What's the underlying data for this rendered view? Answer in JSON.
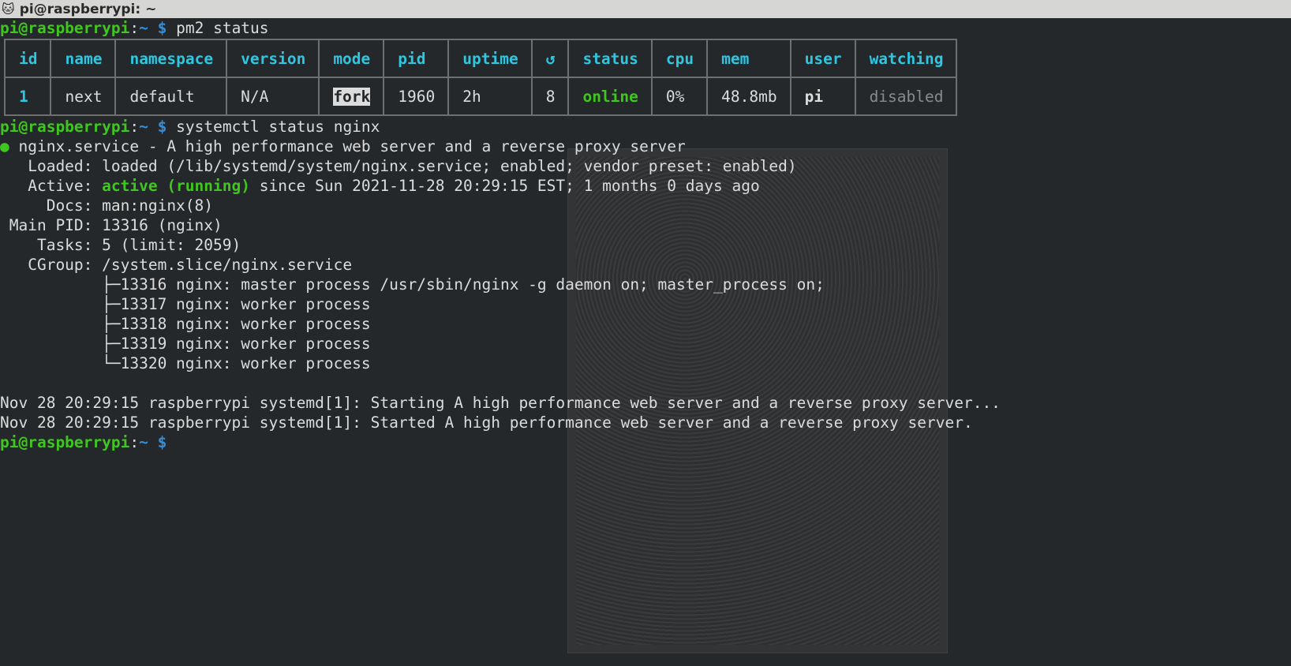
{
  "window": {
    "title": "pi@raspberrypi: ~"
  },
  "prompt": {
    "user_host": "pi@raspberrypi",
    "sep": ":",
    "path": "~",
    "symbol": "$"
  },
  "cmd1": "pm2 status",
  "pm2_table": {
    "headers": [
      "id",
      "name",
      "namespace",
      "version",
      "mode",
      "pid",
      "uptime",
      "↺",
      "status",
      "cpu",
      "mem",
      "user",
      "watching"
    ],
    "row": {
      "id": "1",
      "name": "next",
      "namespace": "default",
      "version": "N/A",
      "mode": "fork",
      "pid": "1960",
      "uptime": "2h",
      "restarts": "8",
      "status": "online",
      "cpu": "0%",
      "mem": "48.8mb",
      "user": "pi",
      "watching": "disabled"
    }
  },
  "cmd2": "systemctl status nginx",
  "nginx": {
    "dot": "●",
    "service_line": " nginx.service - A high performance web server and a reverse proxy server",
    "loaded": "   Loaded: loaded (/lib/systemd/system/nginx.service; enabled; vendor preset: enabled)",
    "active_label": "   Active: ",
    "active_state": "active (running)",
    "active_rest": " since Sun 2021-11-28 20:29:15 EST; 1 months 0 days ago",
    "docs": "     Docs: man:nginx(8)",
    "main_pid": " Main PID: 13316 (nginx)",
    "tasks": "    Tasks: 5 (limit: 2059)",
    "cgroup": "   CGroup: /system.slice/nginx.service",
    "tree": [
      "           ├─13316 nginx: master process /usr/sbin/nginx -g daemon on; master_process on;",
      "           ├─13317 nginx: worker process",
      "           ├─13318 nginx: worker process",
      "           ├─13319 nginx: worker process",
      "           └─13320 nginx: worker process"
    ],
    "logs": [
      "Nov 28 20:29:15 raspberrypi systemd[1]: Starting A high performance web server and a reverse proxy server...",
      "Nov 28 20:29:15 raspberrypi systemd[1]: Started A high performance web server and a reverse proxy server."
    ]
  },
  "colors": {
    "background": "#25282a",
    "prompt_green": "#3fc71f",
    "prompt_blue": "#2f8fe0",
    "header_cyan": "#2ec6e0",
    "text": "#dcdcdc"
  }
}
